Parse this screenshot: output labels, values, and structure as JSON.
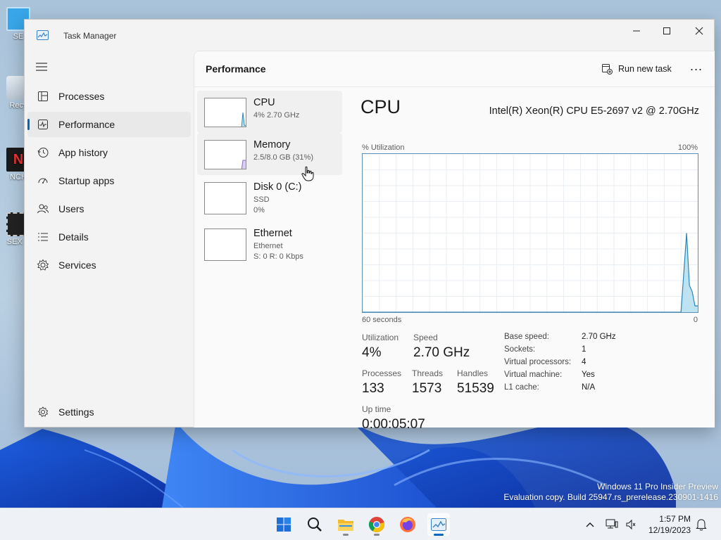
{
  "desktop": {
    "icons": [
      {
        "label": "SE"
      },
      {
        "label": "Recy"
      },
      {
        "label": "NCH"
      },
      {
        "label": "SEX E"
      }
    ],
    "watermark": {
      "line1": "Windows 11 Pro Insider Preview",
      "line2": "Evaluation copy. Build 25947.rs_prerelease.230901-1416"
    }
  },
  "window": {
    "title": "Task Manager",
    "controls": {
      "minimize": "minimize-icon",
      "maximize": "maximize-icon",
      "close": "close-icon"
    }
  },
  "sidebar": {
    "items": [
      {
        "label": "Processes",
        "icon": "processes-icon"
      },
      {
        "label": "Performance",
        "icon": "performance-icon",
        "active": true
      },
      {
        "label": "App history",
        "icon": "app-history-icon"
      },
      {
        "label": "Startup apps",
        "icon": "startup-apps-icon"
      },
      {
        "label": "Users",
        "icon": "users-icon"
      },
      {
        "label": "Details",
        "icon": "details-icon"
      },
      {
        "label": "Services",
        "icon": "services-icon"
      }
    ],
    "settings_label": "Settings"
  },
  "header": {
    "title": "Performance",
    "run_new_task": "Run new task",
    "more": "..."
  },
  "devices": [
    {
      "name": "CPU",
      "lines": [
        "4% 2.70 GHz"
      ],
      "selected": true
    },
    {
      "name": "Memory",
      "lines": [
        "2.5/8.0 GB (31%)"
      ],
      "hovered": true
    },
    {
      "name": "Disk 0 (C:)",
      "lines": [
        "SSD",
        "0%"
      ]
    },
    {
      "name": "Ethernet",
      "lines": [
        "Ethernet",
        "S: 0 R: 0 Kbps"
      ]
    }
  ],
  "detail": {
    "heading": "CPU",
    "model": "Intel(R) Xeon(R) CPU E5-2697 v2 @ 2.70GHz",
    "graph_top_left": "% Utilization",
    "graph_top_right": "100%",
    "graph_bottom_left": "60 seconds",
    "graph_bottom_right": "0",
    "stats": {
      "utilization_label": "Utilization",
      "utilization": "4%",
      "speed_label": "Speed",
      "speed": "2.70 GHz",
      "processes_label": "Processes",
      "processes": "133",
      "threads_label": "Threads",
      "threads": "1573",
      "handles_label": "Handles",
      "handles": "51539",
      "uptime_label": "Up time",
      "uptime": "0:00:05:07"
    },
    "properties": [
      {
        "label": "Base speed:",
        "value": "2.70 GHz"
      },
      {
        "label": "Sockets:",
        "value": "1"
      },
      {
        "label": "Virtual processors:",
        "value": "4"
      },
      {
        "label": "Virtual machine:",
        "value": "Yes"
      },
      {
        "label": "L1 cache:",
        "value": "N/A"
      }
    ]
  },
  "chart_data": {
    "type": "area",
    "title": "",
    "xlabel": "60 seconds",
    "ylabel": "% Utilization",
    "x": [
      60,
      3,
      2,
      1.5,
      1,
      0.5,
      0
    ],
    "y": [
      0,
      0,
      50,
      17,
      13,
      4,
      4
    ],
    "xlim": [
      60,
      0
    ],
    "ylim": [
      0,
      100
    ],
    "grid": true,
    "colors": {
      "line": "#2a86b8",
      "fill": "#bde3f3"
    }
  },
  "taskbar": {
    "apps": [
      {
        "name": "start-icon"
      },
      {
        "name": "search-icon"
      },
      {
        "name": "file-explorer-icon",
        "running": true
      },
      {
        "name": "chrome-icon",
        "running": true
      },
      {
        "name": "firefox-icon"
      },
      {
        "name": "task-manager-icon",
        "running": true,
        "active": true
      }
    ],
    "tray": [
      "chevron-up-icon",
      "network-icon",
      "volume-icon"
    ],
    "time": "1:57 PM",
    "date": "12/19/2023",
    "notification": "bell-icon"
  },
  "colors": {
    "accent": "#0067c0",
    "graph_border": "#5b8fb5",
    "graph_line": "#2a86b8",
    "graph_fill": "#bde3f3"
  }
}
